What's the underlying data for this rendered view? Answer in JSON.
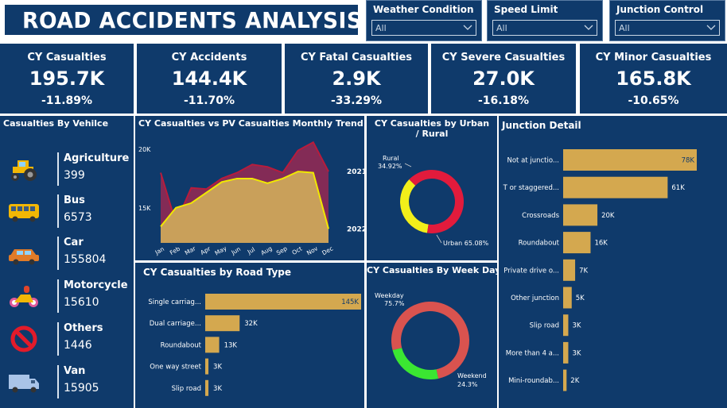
{
  "title": "ROAD ACCIDENTS ANALYSIS",
  "slicers": [
    {
      "label": "Weather Condition",
      "value": "All"
    },
    {
      "label": "Speed Limit",
      "value": "All"
    },
    {
      "label": "Junction Control",
      "value": "All"
    }
  ],
  "kpis": [
    {
      "title": "CY Casualties",
      "value": "195.7K",
      "change": "-11.89%"
    },
    {
      "title": "CY Accidents",
      "value": "144.4K",
      "change": "-11.70%"
    },
    {
      "title": "CY Fatal Casualties",
      "value": "2.9K",
      "change": "-33.29%"
    },
    {
      "title": "CY Severe Casualties",
      "value": "27.0K",
      "change": "-16.18%"
    },
    {
      "title": "CY Minor Casualties",
      "value": "165.8K",
      "change": "-10.65%"
    }
  ],
  "vehicles": {
    "title": "Casualties By Vehilce",
    "items": [
      {
        "name": "Agriculture",
        "value": "399",
        "icon": "tractor-icon"
      },
      {
        "name": "Bus",
        "value": "6573",
        "icon": "bus-icon"
      },
      {
        "name": "Car",
        "value": "155804",
        "icon": "car-icon"
      },
      {
        "name": "Motorcycle",
        "value": "15610",
        "icon": "motorcycle-icon"
      },
      {
        "name": "Others",
        "value": "1446",
        "icon": "no-entry-icon"
      },
      {
        "name": "Van",
        "value": "15905",
        "icon": "van-icon"
      }
    ]
  },
  "colors": {
    "panel": "#0f3a6b",
    "bar": "#d4a84f",
    "trend_2021": "#b81c3c",
    "trend_2022": "#f0e800",
    "urban": "#e21b3c",
    "rural": "#f2ef1a",
    "weekday": "#d9534f",
    "weekend": "#3be632"
  },
  "chart_data": [
    {
      "type": "area",
      "title": "CY Casualties vs PV Casualties Monthly Trend",
      "categories": [
        "Jan",
        "Feb",
        "Mar",
        "Apr",
        "May",
        "Jun",
        "Jul",
        "Aug",
        "Sep",
        "Oct",
        "Nov",
        "Dec"
      ],
      "ytick_labels": [
        "20K",
        "15K"
      ],
      "yticks": [
        20000,
        15000
      ],
      "ylim": [
        12000,
        21500
      ],
      "series": [
        {
          "name": "2021",
          "values": [
            18000,
            13700,
            16700,
            16600,
            17500,
            18000,
            18700,
            18500,
            18000,
            19900,
            20600,
            18100
          ]
        },
        {
          "name": "2022",
          "values": [
            13400,
            15000,
            15400,
            16300,
            17200,
            17500,
            17500,
            17100,
            17500,
            18100,
            18000,
            13200
          ]
        }
      ]
    },
    {
      "type": "pie",
      "title": "CY Casualties by Urban / Rural",
      "labels": [
        "Rural",
        "Urban"
      ],
      "values": [
        34.92,
        65.08
      ],
      "value_labels": [
        "34.92%",
        "Urban 65.08%"
      ]
    },
    {
      "type": "bar",
      "title": "Junction Detail",
      "categories": [
        "Not at junctio...",
        "T or staggered...",
        "Crossroads",
        "Roundabout",
        "Private drive o...",
        "Other junction",
        "Slip road",
        "More than 4 a...",
        "Mini-roundab..."
      ],
      "values": [
        78,
        61,
        20,
        16,
        7,
        5,
        3,
        3,
        2
      ],
      "value_labels": [
        "78K",
        "61K",
        "20K",
        "16K",
        "7K",
        "5K",
        "3K",
        "3K",
        "2K"
      ]
    },
    {
      "type": "bar",
      "title": "CY Casualties by Road Type",
      "categories": [
        "Single carriag...",
        "Dual carriage...",
        "Roundabout",
        "One way street",
        "Slip road"
      ],
      "values": [
        145,
        32,
        13,
        3,
        3
      ],
      "value_labels": [
        "145K",
        "32K",
        "13K",
        "3K",
        "3K"
      ]
    },
    {
      "type": "pie",
      "title": "CY Casualties By Week Day",
      "labels": [
        "Weekday",
        "Weekend"
      ],
      "values": [
        75.7,
        24.3
      ],
      "value_labels": [
        "75.7%",
        "24.3%"
      ]
    }
  ]
}
